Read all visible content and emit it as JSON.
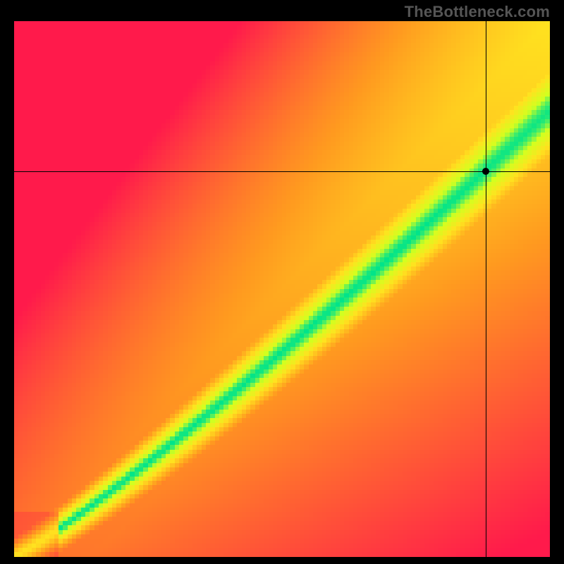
{
  "watermark": "TheBottleneck.com",
  "chart_data": {
    "type": "heatmap",
    "title": "",
    "xlabel": "",
    "ylabel": "",
    "xlim": [
      0,
      100
    ],
    "ylim": [
      0,
      100
    ],
    "grid": false,
    "legend": false,
    "description": "Bottleneck compatibility heatmap. Green diagonal ridge marks balanced CPU/GPU pairings; red regions indicate severe bottleneck; yellow is borderline.",
    "optimal_curve": {
      "type": "power",
      "approx_points_xy": [
        [
          0,
          0
        ],
        [
          20,
          13
        ],
        [
          40,
          27
        ],
        [
          60,
          43
        ],
        [
          80,
          62
        ],
        [
          100,
          83
        ]
      ],
      "green_band_halfwidth_pct": 5
    },
    "marker": {
      "x": 88,
      "y": 72,
      "zone": "yellow-upper"
    },
    "colorscale": [
      {
        "stop": 0.0,
        "color": "#ff1a4b"
      },
      {
        "stop": 0.45,
        "color": "#ff9a1f"
      },
      {
        "stop": 0.7,
        "color": "#ffe21f"
      },
      {
        "stop": 0.88,
        "color": "#d3ff1f"
      },
      {
        "stop": 1.0,
        "color": "#00e48a"
      }
    ],
    "pixelation_cells": 120
  }
}
